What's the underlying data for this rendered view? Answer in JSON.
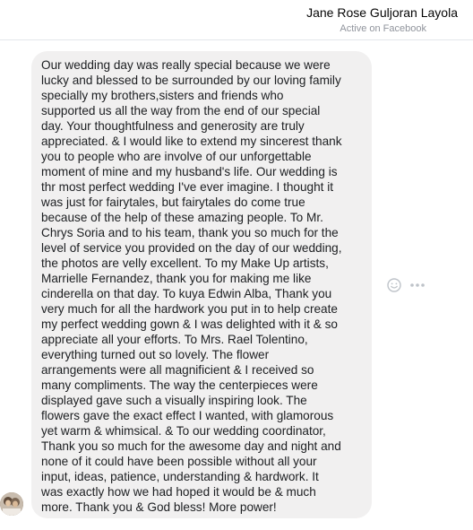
{
  "header": {
    "contact_name": "Jane Rose Guljoran Layola",
    "status": "Active on Facebook"
  },
  "message": {
    "lines": [
      "Our wedding day was really special because we were",
      "lucky and blessed to be surrounded by our loving family",
      "specially my brothers,sisters and friends who",
      "supported us all the way from the end of our special",
      "day. Your thoughtfulness and generosity are truly",
      "appreciated. & I would like to extend my sincerest thank",
      "you to people who are involve of our unforgettable",
      "moment of mine and my husband's life. Our wedding is",
      "thr most perfect wedding I've ever imagine. I thought it",
      "was just for fairytales, but fairytales do come true",
      "because of the help of these amazing people. To Mr.",
      "Chrys Soria and to his team, thank you so much for the",
      "level of service you provided on the day of our wedding,",
      "the photos are velly excellent. To my Make Up artists,",
      "Marrielle Fernandez, thank you for making me like",
      "cinderella on that day. To kuya Edwin Alba, Thank you",
      "very much for all the hardwork you put in to help create",
      "my perfect wedding gown & I was delighted with it & so",
      "appreciate all your efforts. To Mrs. Rael Tolentino,",
      "everything turned out so lovely. The flower",
      "arrangements were all magnificient & I received so",
      "many compliments. The way the centerpieces were",
      "displayed gave such a visually inspiring look. The",
      "flowers gave the exact effect I wanted, with glamorous",
      "yet warm & whimsical. & To our wedding coordinator,",
      "Thank you so much for the awesome day and night and",
      "none of it could have been possible without all your",
      "input, ideas, patience, understanding & hardwork. It",
      "was exactly how we had hoped it would be & much",
      "more. Thank you & God bless! More power!"
    ]
  },
  "icons": {
    "react": "smiley-face-icon",
    "more": "more-options-icon",
    "avatar": "sender-avatar"
  },
  "colors": {
    "bubble": "#f1f0f0",
    "text": "#1c1e21",
    "muted": "#90949c",
    "icon": "#bec3c9"
  }
}
